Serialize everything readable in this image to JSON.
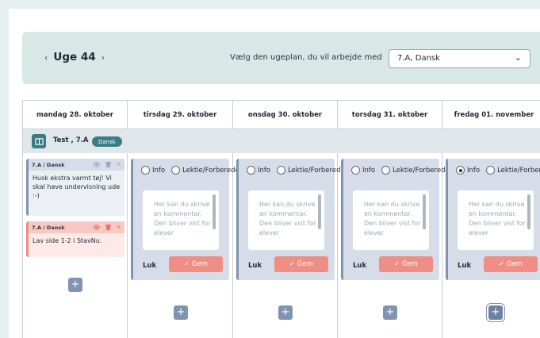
{
  "week": {
    "prev": "‹",
    "label": "Uge 44",
    "next": "›"
  },
  "plan_select": {
    "label": "Vælg den ugeplan, du vil arbejde med",
    "value": "7.A, Dansk"
  },
  "days": [
    {
      "label": "mandag 28. oktober"
    },
    {
      "label": "tirsdag 29. oktober"
    },
    {
      "label": "onsdag 30. oktober"
    },
    {
      "label": "torsdag 31. oktober"
    },
    {
      "label": "fredag 01. november"
    }
  ],
  "subject": {
    "title": "Test , 7.A",
    "tag": "Dansk"
  },
  "notes": [
    {
      "header": "7.A / Dansk",
      "text": "Husk ekstra varmt tøj! Vi skal have undervisning ude :-)"
    },
    {
      "header": "7.A / Dansk",
      "text": "Lav side 1-2 i StavNu."
    }
  ],
  "editor": {
    "option_info": "Info",
    "option_homework": "Lektie/Forberedelse",
    "placeholder": "Her kan du skrive en kommentar. Den bliver vist for elever",
    "close": "Luk",
    "save": "✓ Gem"
  },
  "add_label": "+",
  "colors": {
    "accent": "#3c7c84",
    "save": "#ef8e84",
    "card_border": "#7f93b2"
  }
}
